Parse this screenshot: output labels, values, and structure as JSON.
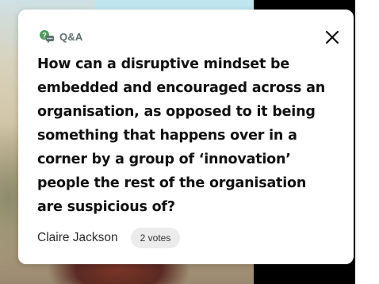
{
  "card": {
    "header": {
      "label": "Q&A",
      "icon": "qa-chat-icon",
      "icon_color": "#4a9e5c"
    },
    "close_icon": "close-icon",
    "question": "How can a disruptive mindset be embedded and encouraged across an organisation, as opposed to it being something that happens over in a corner by a group of ‘innovation’ people the rest of the organisation are suspicious of?",
    "author": "Claire Jackson",
    "votes": "2 votes"
  }
}
